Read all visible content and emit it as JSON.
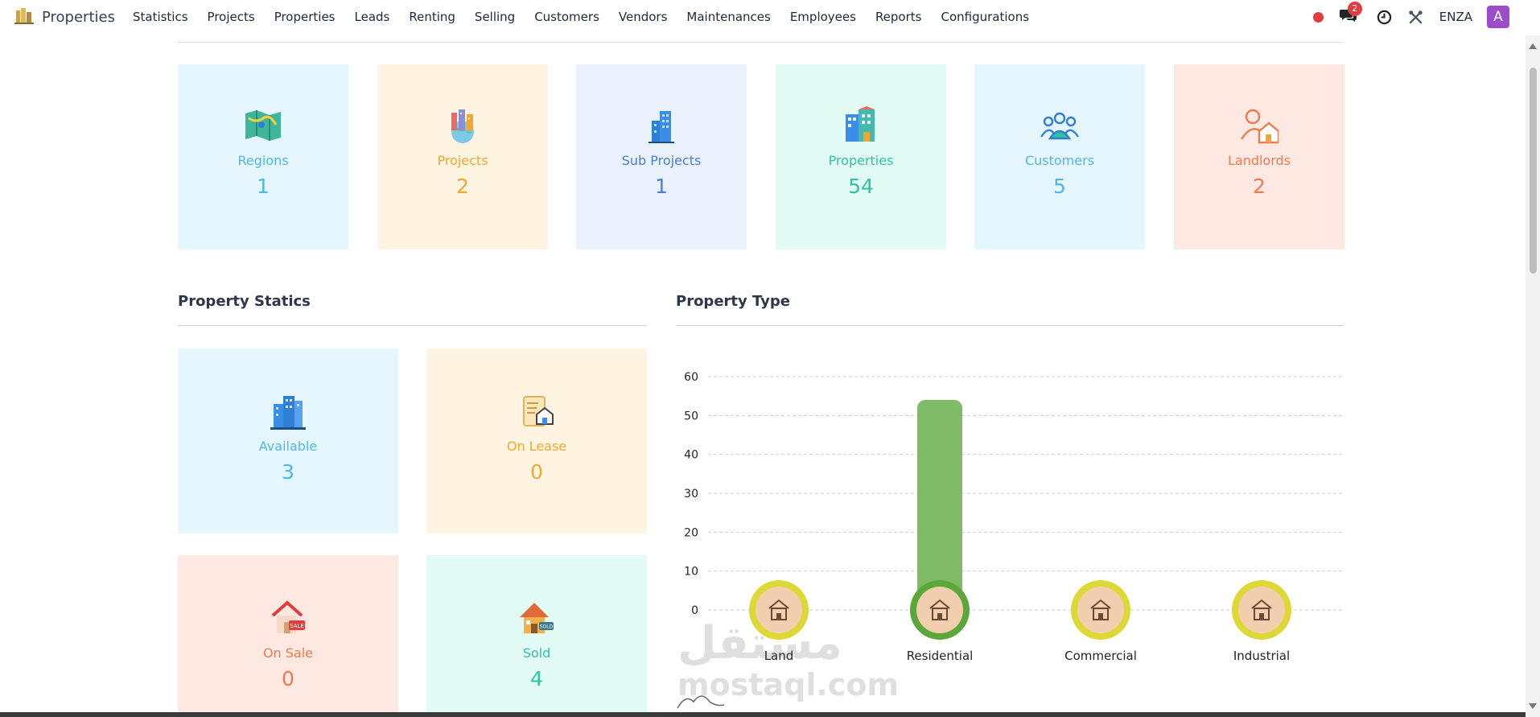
{
  "app": {
    "title": "Properties"
  },
  "nav": {
    "menu": [
      "Statistics",
      "Projects",
      "Properties",
      "Leads",
      "Renting",
      "Selling",
      "Customers",
      "Vendors",
      "Maintenances",
      "Employees",
      "Reports",
      "Configurations"
    ],
    "chat_badge": "2",
    "company": "ENZA",
    "avatar_initial": "A"
  },
  "kpis": [
    {
      "label": "Regions",
      "value": "1",
      "color": "#4db8e8",
      "bg": "#e6f6fe",
      "icon": "map-icon"
    },
    {
      "label": "Projects",
      "value": "2",
      "color": "#f0a830",
      "bg": "#fff3e2",
      "icon": "city-globe-icon"
    },
    {
      "label": "Sub Projects",
      "value": "1",
      "color": "#4a7fd6",
      "bg": "#e9f1fd",
      "icon": "tower-icon"
    },
    {
      "label": "Properties",
      "value": "54",
      "color": "#2ec4a0",
      "bg": "#e2fcf5",
      "icon": "buildings-icon"
    },
    {
      "label": "Customers",
      "value": "5",
      "color": "#4db8e8",
      "bg": "#e6f6fe",
      "icon": "customers-icon"
    },
    {
      "label": "Landlords",
      "value": "2",
      "color": "#f07a50",
      "bg": "#fde8e2",
      "icon": "landlord-icon"
    }
  ],
  "property_statics": {
    "title": "Property Statics",
    "cards": [
      {
        "label": "Available",
        "value": "3",
        "color": "#4db8e8",
        "bg": "#e6f6fe",
        "icon": "available-building-icon"
      },
      {
        "label": "On Lease",
        "value": "0",
        "color": "#f0a830",
        "bg": "#fff3e2",
        "icon": "lease-icon"
      },
      {
        "label": "On Sale",
        "value": "0",
        "color": "#f07a50",
        "bg": "#fde8e2",
        "icon": "sale-icon"
      },
      {
        "label": "Sold",
        "value": "4",
        "color": "#2ec4a0",
        "bg": "#e2fcf5",
        "icon": "sold-icon"
      }
    ]
  },
  "property_type": {
    "title": "Property Type",
    "chart_data": {
      "type": "bar",
      "categories": [
        "Land",
        "Residential",
        "Commercial",
        "Industrial"
      ],
      "values": [
        0,
        54,
        0,
        0
      ],
      "ylim": [
        0,
        60
      ],
      "yticks": [
        0,
        10,
        20,
        30,
        40,
        50,
        60
      ],
      "grid": true,
      "bar_color": "#80bc68",
      "marker_ring_color": "#dcd936",
      "active_ring_color": "#5aa83c"
    }
  },
  "watermark": {
    "arabic": "مستقل",
    "latin": "mostaql.com"
  }
}
